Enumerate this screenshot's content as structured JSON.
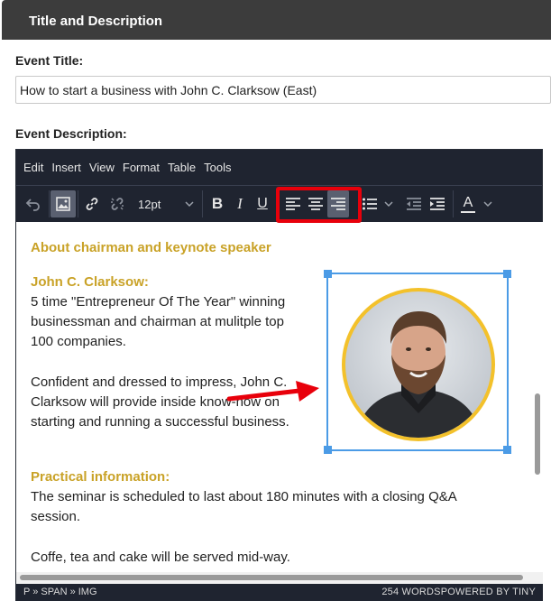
{
  "panel": {
    "title": "Title and Description"
  },
  "event_title": {
    "label": "Event Title:",
    "value": "How to start a business with John C. Clarksow (East)"
  },
  "event_description": {
    "label": "Event Description:"
  },
  "editor": {
    "menu": [
      "Edit",
      "Insert",
      "View",
      "Format",
      "Table",
      "Tools"
    ],
    "toolbar": {
      "font_size": "12pt",
      "icons": [
        "undo-icon",
        "image-icon",
        "link-icon",
        "unlink-icon",
        "bold-icon",
        "italic-icon",
        "underline-icon",
        "align-left-icon",
        "align-center-icon",
        "align-right-icon",
        "bullet-list-icon",
        "outdent-icon",
        "indent-icon",
        "text-color-icon"
      ],
      "bold": "B",
      "italic": "I",
      "underline": "U",
      "text_color_letter": "A",
      "active_tools": [
        "image",
        "align-right"
      ]
    },
    "content": {
      "heading": "About chairman and keynote speaker",
      "speaker_name": "John C. Clarksow:",
      "bio_lines": [
        "5 time \"Entrepreneur Of The Year\" winning",
        "businessman and chairman at mulitple top",
        "100 companies."
      ],
      "desc_lines": [
        "Confident and dressed to impress, John C.",
        "Clarksow will provide inside know-how on",
        "starting and running a successful business."
      ],
      "practical_heading": "Practical information:",
      "seminar_lines": [
        "The seminar is scheduled to last about 180 minutes with a closing Q&A",
        "session."
      ],
      "coffee_line": "Coffe, tea and cake will be served mid-way."
    },
    "status": {
      "path": "P » SPAN » IMG",
      "word_count": "254 WORDS",
      "powered_by": "POWERED BY TINY"
    }
  },
  "colors": {
    "header_bg": "#3c3c3c",
    "toolbar_bg": "#1f2430",
    "accent_gold": "#c9a227",
    "selection_blue": "#4b9be6",
    "highlight_red": "#e8000b",
    "portrait_ring": "#f3c12b"
  }
}
